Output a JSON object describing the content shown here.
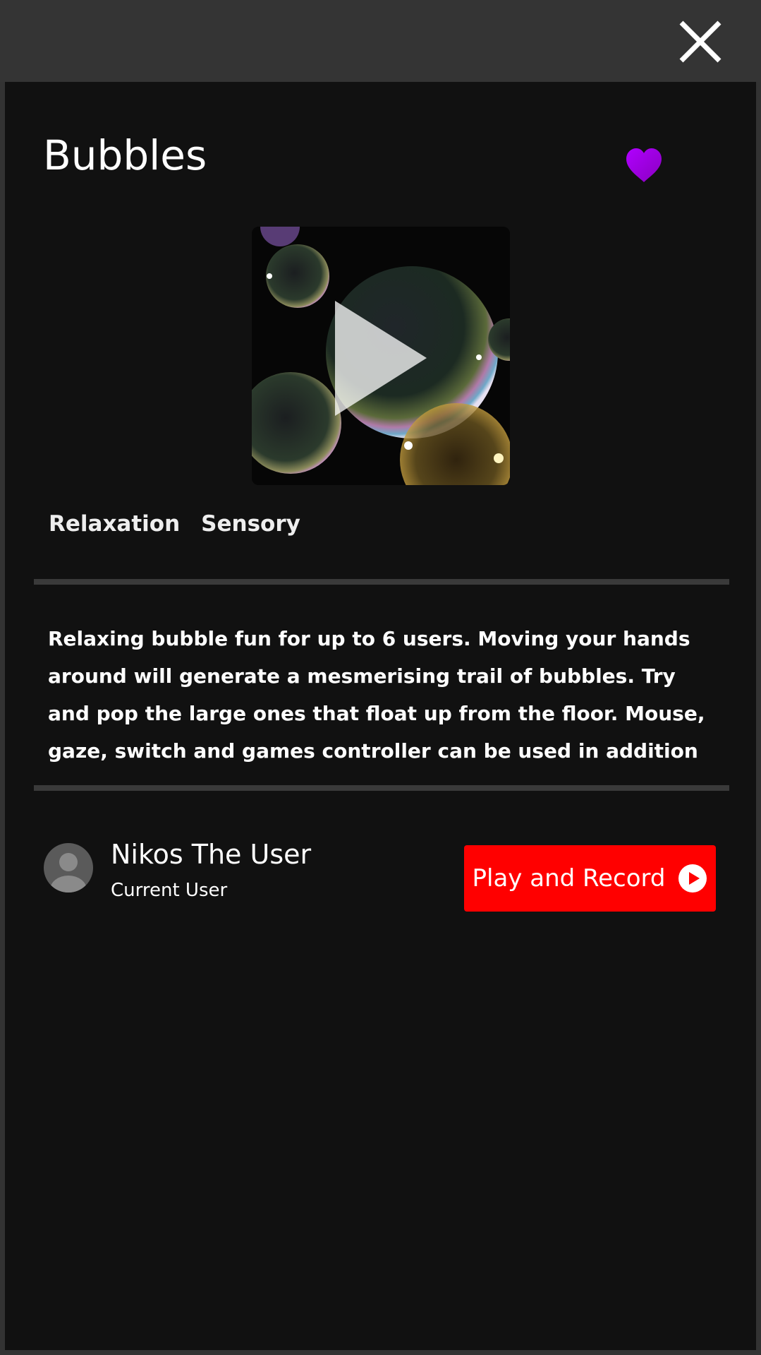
{
  "window": {
    "close_icon": "close-icon"
  },
  "activity": {
    "title": "Bubbles",
    "favorite_icon": "heart-icon",
    "favorite_color": "#9b00d8",
    "thumbnail_icon": "play-icon",
    "tags": [
      "Relaxation",
      "Sensory"
    ],
    "description": "Relaxing bubble fun for up to 6 users. Moving your hands around will generate a mesmerising trail of bubbles. Try and pop the large ones that float up from the floor. Mouse, gaze, switch and games controller can be used in addition to interact with the"
  },
  "user": {
    "name": "Nikos The User",
    "role": "Current User",
    "avatar_icon": "user-avatar-icon"
  },
  "actions": {
    "play_record_label": "Play and Record",
    "play_record_icon": "play-circle-icon",
    "play_record_color": "#ff0000"
  }
}
